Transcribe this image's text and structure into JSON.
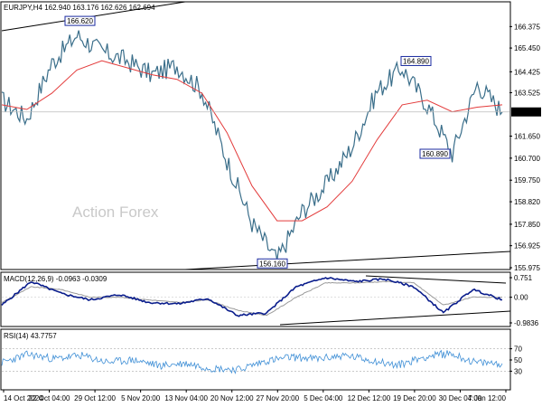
{
  "colors": {
    "price": "#3a6e8a",
    "ma": "#e33b3b",
    "macd": "#0a1d8c",
    "signal": "#9a9a9a",
    "rsi": "#3f8fd6",
    "trendline": "#000000",
    "label_border": "#1a2aa0",
    "label_text": "#1a2aa0",
    "watermark": "#c9c9c9"
  },
  "chart_data": [
    {
      "type": "line",
      "panel": "price",
      "header": "EURJPY,H4  162.940 163.176 162.626 162.694",
      "watermark": "Action Forex",
      "ylim": [
        155.975,
        166.975
      ],
      "yticks": [
        "166.375",
        "165.450",
        "164.425",
        "163.525",
        "162.694",
        "161.650",
        "160.700",
        "159.750",
        "158.820",
        "157.850",
        "156.925",
        "155.975"
      ],
      "ytick_values": [
        166.375,
        165.45,
        164.425,
        163.525,
        162.694,
        161.65,
        160.7,
        159.75,
        158.82,
        157.85,
        156.925,
        155.975
      ],
      "last_price": 162.694,
      "x": [
        "14 Oct 2024",
        "22 Oct 04:00",
        "29 Oct 12:00",
        "5 Nov 20:00",
        "13 Nov 04:00",
        "20 Nov 12:00",
        "27 Nov 20:00",
        "5 Dec 04:00",
        "12 Dec 12:00",
        "19 Dec 20:00",
        "30 Dec 04:00",
        "7 Jan 12:00"
      ],
      "close": [
        163.2,
        162.4,
        164.8,
        166.0,
        165.3,
        164.9,
        164.3,
        164.7,
        163.6,
        160.6,
        157.9,
        156.3,
        158.4,
        159.6,
        161.2,
        163.6,
        164.6,
        163.0,
        160.9,
        163.9,
        162.69
      ],
      "moving_average": [
        163.0,
        162.8,
        163.5,
        164.5,
        164.9,
        164.6,
        164.3,
        164.1,
        163.5,
        161.8,
        159.5,
        158.0,
        158.0,
        158.6,
        159.7,
        161.5,
        163.0,
        163.2,
        162.7,
        162.9,
        163.0
      ],
      "annotations": [
        {
          "text": "166.620",
          "value": 166.62
        },
        {
          "text": "164.890",
          "value": 164.89
        },
        {
          "text": "160.890",
          "value": 160.89
        },
        {
          "text": "156.160",
          "value": 156.16
        }
      ]
    },
    {
      "type": "line",
      "panel": "macd",
      "header": "MACD(12,26,9) -0.0963 -0.0309",
      "ylim": [
        -0.9836,
        0.751
      ],
      "yticks": [
        "0.751",
        "0.00",
        "-0.9836"
      ],
      "ytick_values": [
        0.751,
        0.0,
        -0.9836
      ],
      "series": [
        {
          "values": [
            -0.3,
            0.6,
            0.15,
            -0.1,
            0.1,
            -0.2,
            -0.25,
            -0.05,
            -0.7,
            -0.6,
            0.4,
            0.75,
            0.6,
            0.7,
            0.4,
            -0.6,
            0.3,
            -0.1
          ]
        },
        {
          "values": [
            -0.2,
            0.4,
            0.3,
            0.0,
            0.0,
            -0.1,
            -0.2,
            -0.1,
            -0.5,
            -0.7,
            0.0,
            0.55,
            0.55,
            0.6,
            0.55,
            -0.3,
            0.0,
            0.0
          ]
        }
      ]
    },
    {
      "type": "line",
      "panel": "rsi",
      "header": "RSI(14) 43.7757",
      "ylim": [
        0,
        100
      ],
      "yticks": [
        "70",
        "50",
        "30"
      ],
      "ytick_values": [
        70,
        50,
        30
      ],
      "values": [
        45,
        60,
        52,
        58,
        46,
        50,
        40,
        44,
        35,
        33,
        48,
        55,
        52,
        58,
        50,
        40,
        55,
        62,
        45,
        43.78
      ]
    }
  ]
}
